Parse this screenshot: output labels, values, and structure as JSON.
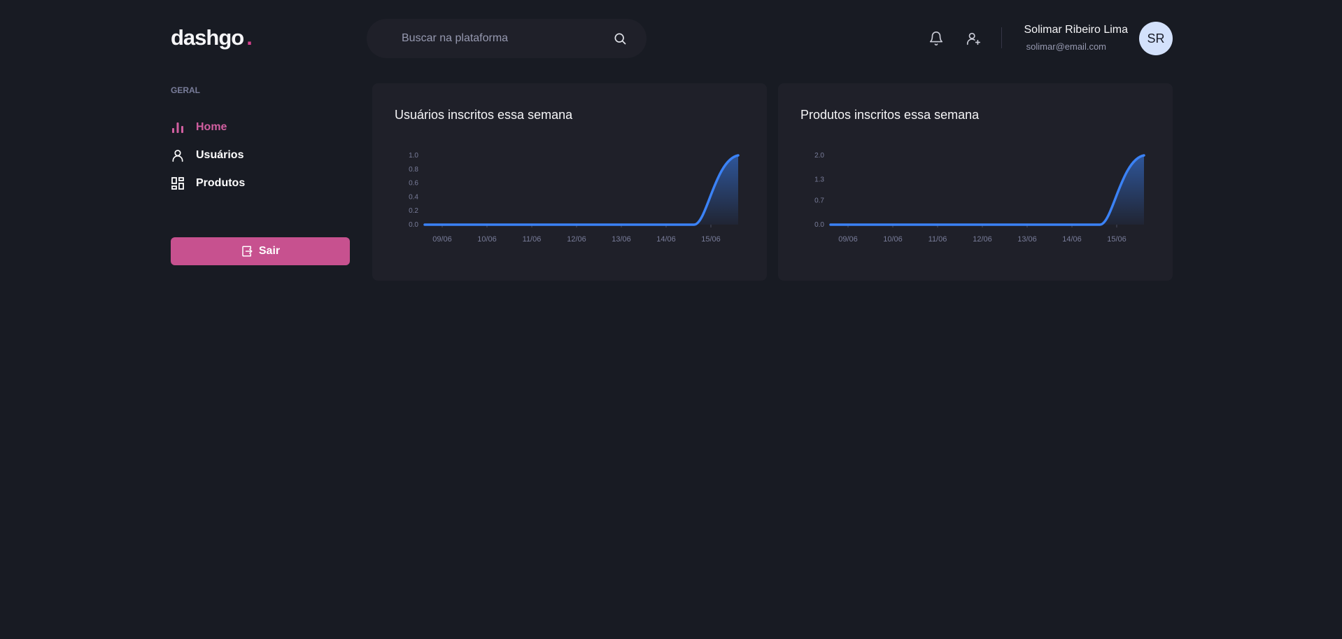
{
  "logo": {
    "text": "dashgo",
    "dot": "."
  },
  "search": {
    "placeholder": "Buscar na plataforma"
  },
  "header": {
    "notifications_icon": "bell-icon",
    "add_user_icon": "user-add-icon",
    "profile": {
      "name": "Solimar Ribeiro Lima",
      "email": "solimar@email.com",
      "initials": "SR"
    }
  },
  "sidebar": {
    "section_title": "GERAL",
    "items": [
      {
        "label": "Home",
        "icon": "bar-chart-icon",
        "active": true
      },
      {
        "label": "Usuários",
        "icon": "user-icon",
        "active": false
      },
      {
        "label": "Produtos",
        "icon": "grid-icon",
        "active": false
      }
    ],
    "logout_label": "Sair"
  },
  "colors": {
    "background": "#181b23",
    "card": "#1f2029",
    "accent_pink": "#d53f8c",
    "logout_button": "#c7518f",
    "chart_line": "#3b82f6",
    "muted_text": "#797d9a"
  },
  "chart_data": [
    {
      "type": "area",
      "title": "Usuários inscritos essa semana",
      "x": [
        "09/06",
        "10/06",
        "11/06",
        "12/06",
        "13/06",
        "14/06",
        "15/06"
      ],
      "categories": [
        "09/06",
        "10/06",
        "11/06",
        "12/06",
        "13/06",
        "14/06",
        "15/06"
      ],
      "series": [
        {
          "values": [
            0,
            0,
            0,
            0,
            0,
            0,
            1
          ]
        }
      ],
      "yticks": [
        "0.0",
        "0.2",
        "0.4",
        "0.6",
        "0.8",
        "1.0"
      ],
      "ylim": [
        0,
        1
      ],
      "grid": false
    },
    {
      "type": "area",
      "title": "Produtos inscritos essa semana",
      "x": [
        "09/06",
        "10/06",
        "11/06",
        "12/06",
        "13/06",
        "14/06",
        "15/06"
      ],
      "categories": [
        "09/06",
        "10/06",
        "11/06",
        "12/06",
        "13/06",
        "14/06",
        "15/06"
      ],
      "series": [
        {
          "values": [
            0,
            0,
            0,
            0,
            0,
            0,
            2
          ]
        }
      ],
      "yticks": [
        "0.0",
        "0.7",
        "1.3",
        "2.0"
      ],
      "ylim": [
        0,
        2
      ],
      "grid": false
    }
  ]
}
